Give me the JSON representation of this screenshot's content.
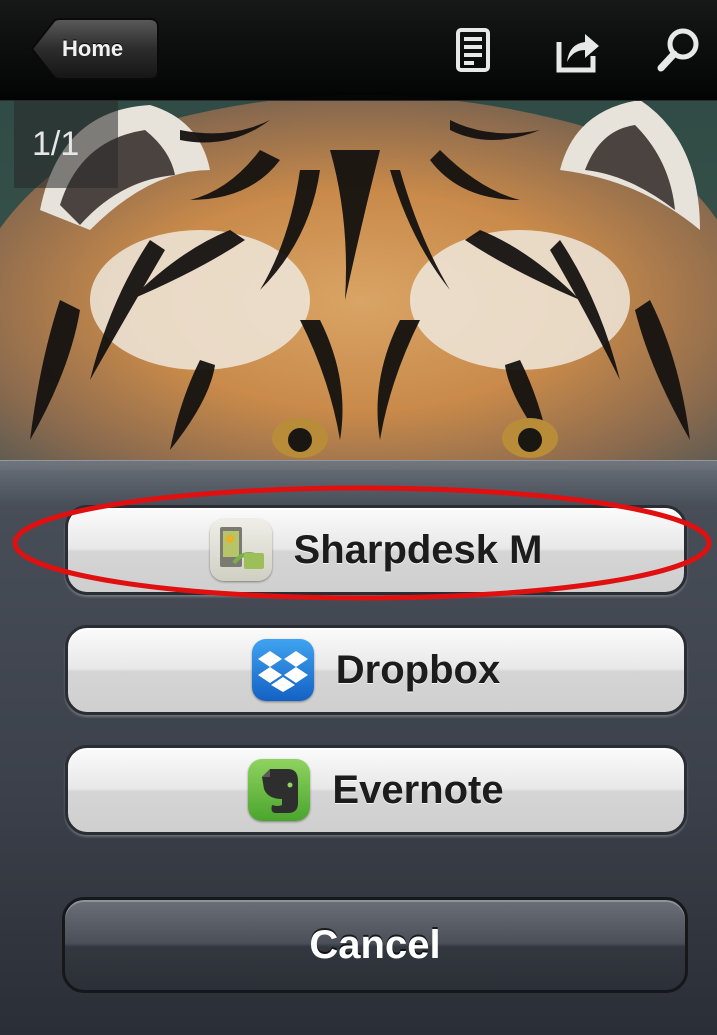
{
  "navbar": {
    "back_label": "Home",
    "icons": [
      "document-list-icon",
      "share-icon",
      "search-icon"
    ]
  },
  "viewer": {
    "page_counter": "1/1"
  },
  "action_sheet": {
    "buttons": [
      {
        "label": "Sharpdesk M",
        "icon": "sharpdesk-m-app-icon",
        "highlighted": true,
        "highlight_color": "#e01010"
      },
      {
        "label": "Dropbox",
        "icon": "dropbox-app-icon"
      },
      {
        "label": "Evernote",
        "icon": "evernote-app-icon"
      }
    ],
    "cancel_label": "Cancel"
  },
  "colors": {
    "navbar": "#000000",
    "sheet_bg": "#3c414b",
    "highlight": "#e01010"
  }
}
